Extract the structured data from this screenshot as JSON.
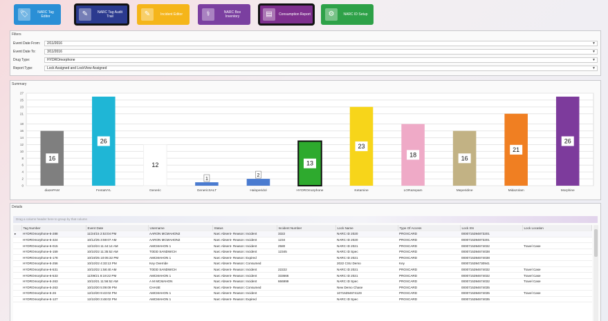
{
  "toolbar": {
    "buttons": [
      {
        "label": "NARC Tag Editor",
        "color": "#2a8fd6",
        "icon": "tag-icon"
      },
      {
        "label": "NARC Tag Audit Trail",
        "color": "#2b3a8f",
        "icon": "audit-icon"
      },
      {
        "label": "Incident Editor",
        "color": "#f5b51a",
        "icon": "incident-icon"
      },
      {
        "label": "NARC Box Inventory",
        "color": "#7b3fa0",
        "icon": "syringe-icon"
      },
      {
        "label": "Consumption Report",
        "color": "#7e2f8e",
        "icon": "report-icon"
      },
      {
        "label": "NARC ID Setup",
        "color": "#2ea148",
        "icon": "id-icon"
      }
    ]
  },
  "filters": {
    "title": "Filters",
    "rows": [
      {
        "label": "Event Date From:",
        "value": "2/11/2016"
      },
      {
        "label": "Event Date To:",
        "value": "3/11/2016"
      },
      {
        "label": "Drug Type:",
        "value": "HYDROmorphone"
      },
      {
        "label": "Report Type:",
        "value": "Lock Assigned and LockView Assigned"
      }
    ]
  },
  "summary": {
    "title": "Summary"
  },
  "chart_data": {
    "type": "bar",
    "categories": [
      "diazePAM",
      "FentaNYL",
      "Generic",
      "GenericSALT",
      "Haloperidol",
      "HYDROmorphone",
      "Ketamine",
      "LORazepam",
      "Meperidine",
      "Midazolam",
      "Morphine"
    ],
    "values": [
      16,
      26,
      12,
      1,
      2,
      13,
      23,
      18,
      16,
      21,
      26
    ],
    "colors": [
      "#7f7f7f",
      "#1fb6d6",
      "#ffffff",
      "#4a7bd0",
      "#4a7bd0",
      "#2eaa2e",
      "#f7d51a",
      "#efaac7",
      "#c2b284",
      "#f07f22",
      "#7d3b9c"
    ],
    "ylim": [
      0,
      27
    ],
    "yticks": [
      0,
      2,
      4,
      6,
      8,
      10,
      12,
      14,
      16,
      18,
      21,
      23,
      25,
      27
    ],
    "grid": true
  },
  "details": {
    "title": "Details",
    "group_hint": "Drag a column header here to group by that column",
    "columns": [
      "Tag Number",
      "Event Date",
      "Username",
      "Status",
      "Incident Number",
      "Lock Name",
      "Type Of Access",
      "Lock SN",
      "Lock Location"
    ],
    "rows": [
      [
        "HYDROmorphone-5-288",
        "11/24/15 2:53:04 PM",
        "AARON MCMAHON2",
        "Narc Absent- Reason: Incident",
        "3322",
        "NARC ID 2020",
        "PROXCARD",
        "0000715394873201",
        ""
      ],
      [
        "HYDROmorphone-5-324",
        "10/12/25 3:59:07 AM",
        "AARON MCMAHON2",
        "Narc Absent- Reason: Incident",
        "1234",
        "NARC ID 2020",
        "PROXCARD",
        "0000715394873201",
        ""
      ],
      [
        "HYDROmorphone-6-015",
        "12/10/24 11:44:14 AM",
        "AMCMAHON 1",
        "Narc Absent- Reason: Incident",
        "2580",
        "NARC ID 2021",
        "PROXCARD",
        "0000715394674032",
        "Travel Case"
      ],
      [
        "HYDROmorphone-5-159",
        "10/10/22 11:35:52 AM",
        "TODD SANDWICH",
        "Narc Absent- Reason: Incident",
        "12345",
        "NARC ID Spec",
        "PROXCARD",
        "0000715394674038",
        ""
      ],
      [
        "HYDROmorphone-5-178",
        "10/19/25 10:05:32 PM",
        "AMCMAHON 1",
        "Narc Absent- Reason: Expired",
        "",
        "NARC ID 2021",
        "PROXCARD",
        "0000715394674038",
        ""
      ],
      [
        "HYDROmorphone-5-256",
        "10/10/22 4:33:13 PM",
        "Key Override",
        "Narc Absent- Reason: Consumed",
        "",
        "2022 CSU Demo",
        "Key",
        "0000715394730941",
        ""
      ],
      [
        "HYDROmorphone-6-531",
        "10/10/22 1:58:40 AM",
        "TODD SANDWICH",
        "Narc Absent- Reason: Incident",
        "22222",
        "NARC ID 2021",
        "PROXCARD",
        "0000715394674032",
        "Travel Case"
      ],
      [
        "HYDROmorphone-6-533",
        "11/09/21 8:19:22 PM",
        "AMCMAHON 1",
        "Narc Absent- Reason: Incident",
        "333666",
        "NARC ID 2021",
        "PROXCARD",
        "0000715394674032",
        "Travel Case"
      ],
      [
        "HYDROmorphone-5-263",
        "10/10/21 11:56:52 AM",
        "A M MCMAHON",
        "Narc Absent- Reason: Incident",
        "666999",
        "NARC ID Spec",
        "PROXCARD",
        "0000715394674032",
        "Travel Case"
      ],
      [
        "HYDROmorphone-5-263",
        "10/10/20 5:09:09 PM",
        "CHASE",
        "Narc Absent- Reason: Consumed",
        "",
        "New Demo Chase",
        "PROXCARD",
        "0000715394674035",
        ""
      ],
      [
        "HYDROmorphone-5-26",
        "12/10/20 9:43:02 PM",
        "AMCMAHON 1",
        "Narc Absent- Reason: Incident",
        "",
        "10715394674129",
        "PROXCARD",
        "0000715394674035",
        "Travel Case"
      ],
      [
        "HYDROmorphone-5-127",
        "12/10/20 3:48:02 PM",
        "AMCMAHON 1",
        "Narc Absent- Reason: Expired",
        "",
        "NARC ID Spec",
        "PROXCARD",
        "0000715394674035",
        ""
      ]
    ]
  }
}
